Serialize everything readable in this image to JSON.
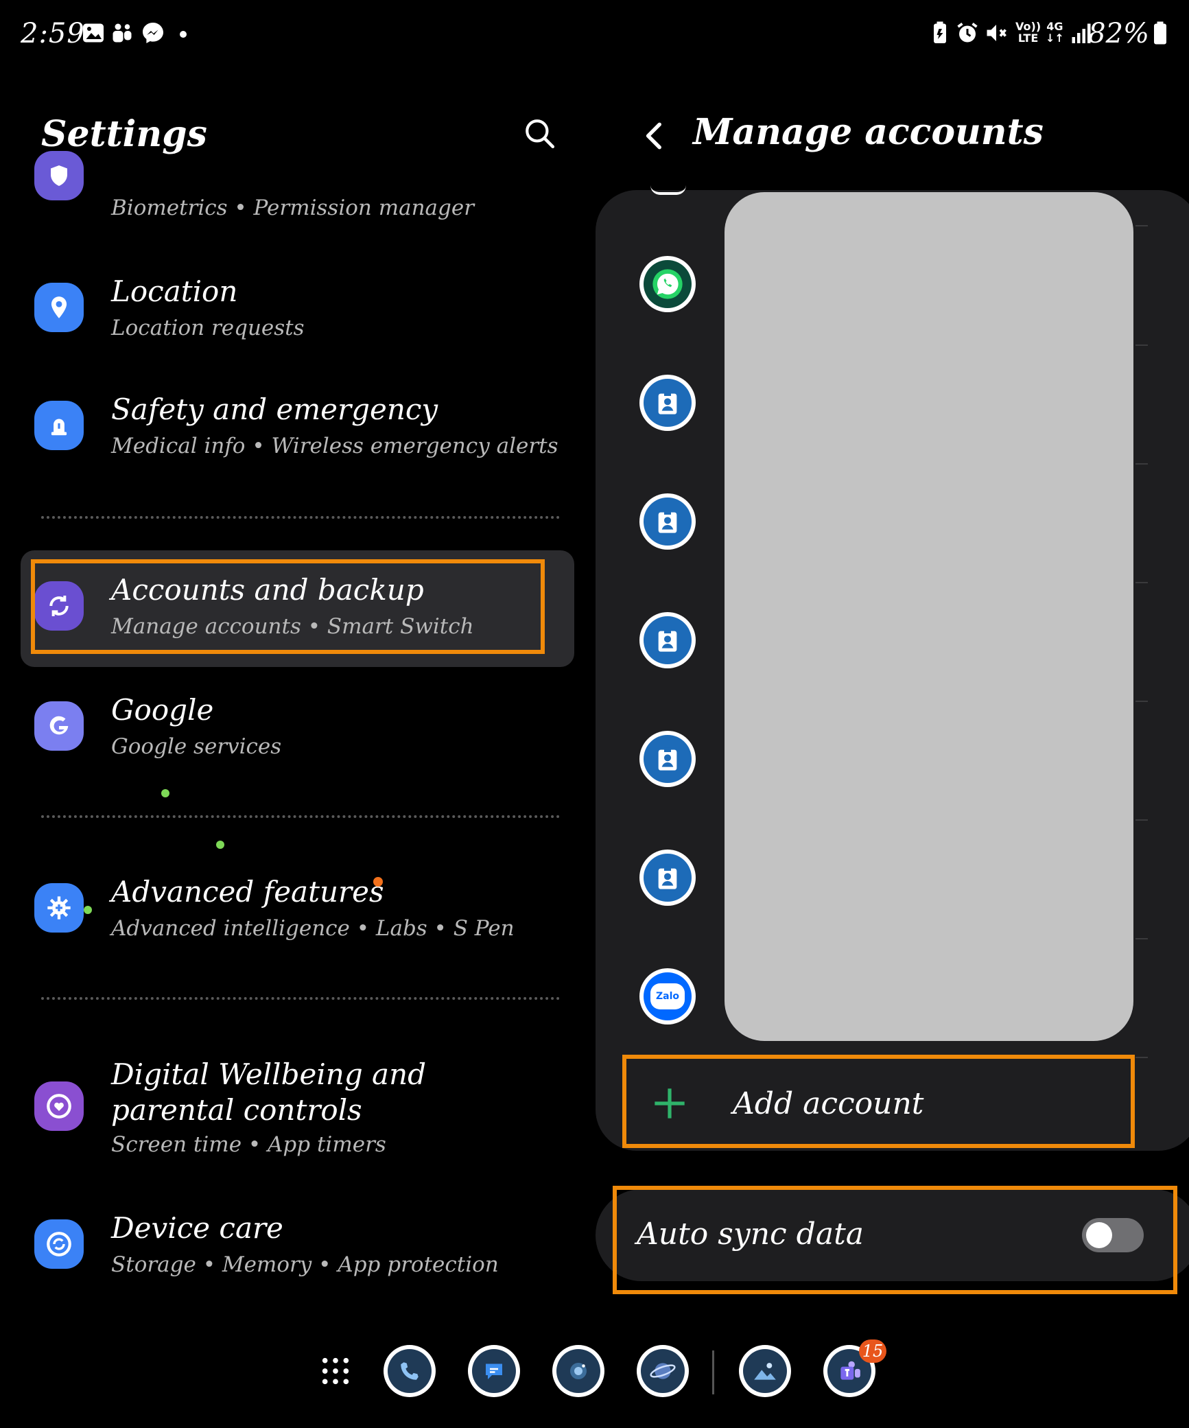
{
  "status_bar": {
    "time": "2:59",
    "battery": "82%",
    "left_icons": [
      "gallery-icon",
      "teams-notification-icon",
      "messenger-icon",
      "dot-icon"
    ],
    "right_icons": [
      "battery-saver-icon",
      "alarm-icon",
      "mute-icon",
      "volte-icon",
      "4g-icon",
      "signal-icon",
      "battery-icon"
    ],
    "network_top": "Vo))",
    "network_bottom": "LTE",
    "data_top": "4G",
    "data_bottom": "↓↑"
  },
  "settings": {
    "title": "Settings",
    "items": [
      {
        "title": "",
        "subtitle": "Biometrics  •  Permission manager",
        "icon": "shield-icon",
        "color": "#6a5ad6"
      },
      {
        "title": "Location",
        "subtitle": "Location requests",
        "icon": "location-pin-icon",
        "color": "#3b82f6"
      },
      {
        "title": "Safety and emergency",
        "subtitle": "Medical info  •  Wireless emergency alerts",
        "icon": "siren-icon",
        "color": "#3b82f6"
      },
      {
        "title": "Accounts and backup",
        "subtitle": "Manage accounts  •  Smart Switch",
        "icon": "sync-icon",
        "color": "#6a4fd1"
      },
      {
        "title": "Google",
        "subtitle": "Google services",
        "icon": "google-g-icon",
        "color": "#7b7ff0"
      },
      {
        "title": "Advanced features",
        "subtitle": "Advanced intelligence  •  Labs  •  S Pen",
        "icon": "puzzle-gear-icon",
        "color": "#3b82f6"
      },
      {
        "title": "Digital Wellbeing and parental controls",
        "subtitle": "Screen time  •  App timers",
        "icon": "heart-circle-icon",
        "color": "#8a4fd1"
      },
      {
        "title": "Device care",
        "subtitle": "Storage  •  Memory  •  App protection",
        "icon": "device-care-icon",
        "color": "#3b82f6"
      }
    ]
  },
  "manage_accounts": {
    "title": "Manage accounts",
    "accounts": [
      {
        "icon": "whatsapp-icon",
        "color": "#25d366"
      },
      {
        "icon": "badge-app-icon",
        "color": "#1d6bb8"
      },
      {
        "icon": "badge-app-icon",
        "color": "#1d6bb8"
      },
      {
        "icon": "badge-app-icon",
        "color": "#1d6bb8"
      },
      {
        "icon": "badge-app-icon",
        "color": "#1d6bb8"
      },
      {
        "icon": "badge-app-icon",
        "color": "#1d6bb8"
      },
      {
        "icon": "zalo-icon",
        "color": "#0068ff",
        "text": "Zalo"
      }
    ],
    "add_account": "Add account",
    "auto_sync": {
      "label": "Auto sync data",
      "enabled": false
    }
  },
  "dock": {
    "apps": [
      "apps-grid-icon",
      "phone-icon",
      "messages-icon",
      "camera-icon",
      "internet-icon",
      "gallery-icon",
      "teams-icon"
    ],
    "badge_count": "15"
  },
  "colors": {
    "highlight": "#f08a0a",
    "background": "#000000",
    "card": "#1e1e20",
    "add_plus": "#2fb36a"
  }
}
